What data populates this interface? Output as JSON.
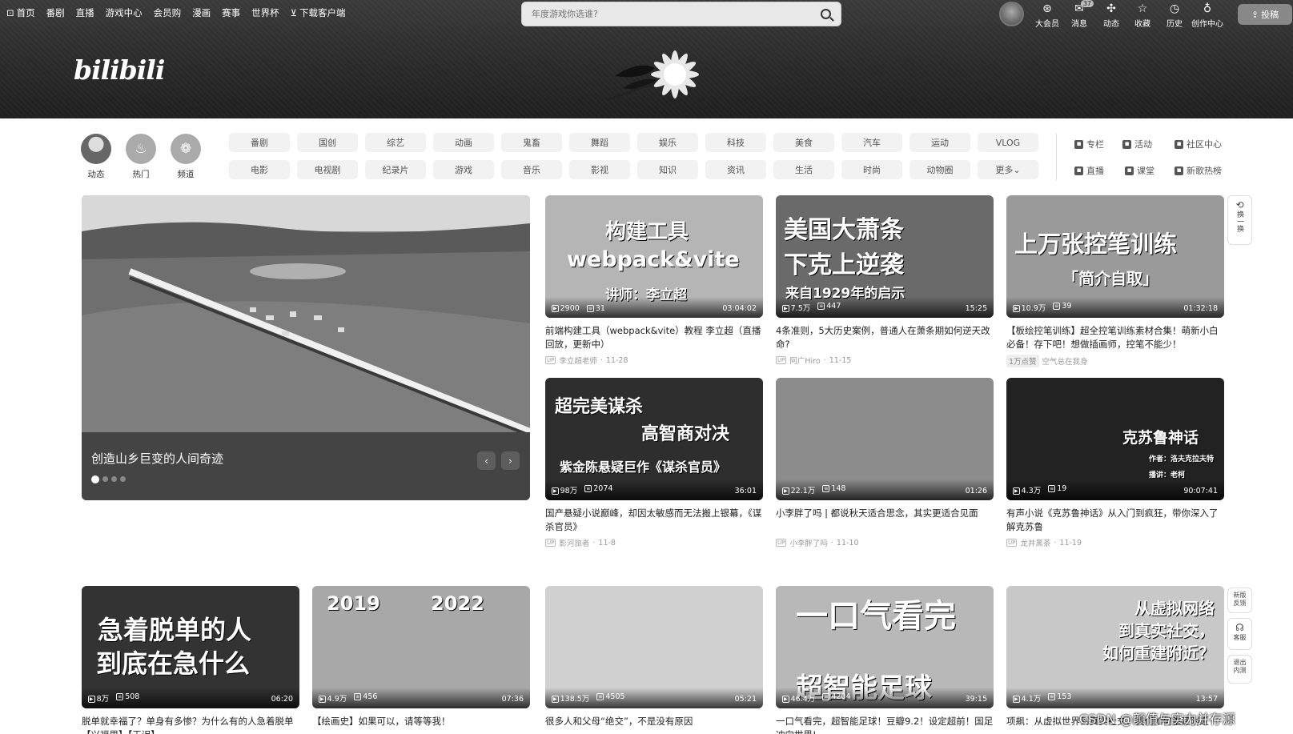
{
  "topnav": [
    "首页",
    "番剧",
    "直播",
    "游戏中心",
    "会员购",
    "漫画",
    "赛事",
    "世界杯",
    "下载客户端"
  ],
  "search": {
    "placeholder": "年度游戏你选谁?"
  },
  "right_icons": [
    {
      "icon": "vip-icon",
      "label": "大会员",
      "glyph": "⊛"
    },
    {
      "icon": "message-icon",
      "label": "消息",
      "glyph": "✉",
      "badge": "37"
    },
    {
      "icon": "dynamic-icon",
      "label": "动态",
      "glyph": "✣"
    },
    {
      "icon": "favorite-icon",
      "label": "收藏",
      "glyph": "☆"
    },
    {
      "icon": "history-icon",
      "label": "历史",
      "glyph": "◷"
    },
    {
      "icon": "creation-icon",
      "label": "创作中心",
      "glyph": "♁"
    }
  ],
  "upload_label": "投稿",
  "logo": "bilibili",
  "side_channels": [
    {
      "label": "动态",
      "icon": "avatar"
    },
    {
      "label": "热门",
      "icon": "fire-icon"
    },
    {
      "label": "频道",
      "icon": "channel-icon"
    }
  ],
  "categories": [
    "番剧",
    "国创",
    "综艺",
    "动画",
    "鬼畜",
    "舞蹈",
    "娱乐",
    "科技",
    "美食",
    "汽车",
    "运动",
    "VLOG",
    "电影",
    "电视剧",
    "纪录片",
    "游戏",
    "音乐",
    "影视",
    "知识",
    "资讯",
    "生活",
    "时尚",
    "动物圈",
    "更多"
  ],
  "extra_links": [
    {
      "label": "专栏",
      "icon": "column-icon"
    },
    {
      "label": "活动",
      "icon": "flag-icon"
    },
    {
      "label": "社区中心",
      "icon": "community-icon"
    },
    {
      "label": "直播",
      "icon": "live-icon"
    },
    {
      "label": "课堂",
      "icon": "classroom-icon"
    },
    {
      "label": "新歌热榜",
      "icon": "music-icon"
    }
  ],
  "carousel": {
    "title": "创造山乡巨变的人间奇迹"
  },
  "refresh_label": "换一换",
  "cards": [
    {
      "title": "前端构建工具（webpack&vite）教程 李立超（直播回放，更新中）",
      "up": "李立超老师",
      "date": "11-28",
      "views": "2900",
      "danmaku": "31",
      "duration": "03:04:02",
      "thumb_text": [
        "构建工具",
        "webpack&vite",
        "讲师：李立超"
      ]
    },
    {
      "title": "4条准则，5大历史案例，普通人在萧条期如何逆天改命?",
      "up": "阿广Hiro",
      "date": "11-15",
      "views": "7.5万",
      "danmaku": "447",
      "duration": "15:25",
      "thumb_text": [
        "美国大萧条",
        "下克上逆袭",
        "来自1929年的启示"
      ]
    },
    {
      "title": "【板绘控笔训练】超全控笔训练素材合集！萌新小白必备！存下吧！想做插画师，控笔不能少！",
      "up": "空气总在我身",
      "date": "",
      "likes": "1万点赞",
      "views": "10.9万",
      "danmaku": "39",
      "duration": "01:32:18",
      "thumb_text": [
        "上万张控笔训练",
        "「简介自取」"
      ]
    },
    {
      "title": "国产悬疑小说巅峰，却因太敏感而无法搬上银幕，《谋杀官员》",
      "up": "影河旅者",
      "date": "11-8",
      "views": "98万",
      "danmaku": "2074",
      "duration": "36:01",
      "thumb_text": [
        "超完美谋杀",
        "高智商对决",
        "紫金陈悬疑巨作《谋杀官员》"
      ]
    },
    {
      "title": "小李胖了吗 | 都说秋天适合思念，其实更适合见面",
      "up": "小李胖了吗",
      "date": "11-10",
      "views": "22.1万",
      "danmaku": "148",
      "duration": "01:26",
      "thumb_text": []
    },
    {
      "title": "有声小说《克苏鲁神话》从入门到疯狂，带你深入了解克苏鲁",
      "up": "龙井黑茶",
      "date": "11-19",
      "views": "4.3万",
      "danmaku": "19",
      "duration": "90:07:41",
      "thumb_text": [
        "克苏鲁神话",
        "作者：洛夫克拉夫特",
        "播讲：老柯"
      ]
    },
    {
      "title": "脱单就幸福了？单身有多惨？为什么有的人急着脱单【兴福里】【王迟】",
      "views": "8万",
      "danmaku": "508",
      "duration": "06:20",
      "thumb_text": [
        "急着脱单的人",
        "到底在急什么"
      ]
    },
    {
      "title": "【绘画史】如果可以，请等等我！",
      "views": "4.9万",
      "danmaku": "456",
      "duration": "07:36",
      "thumb_text": [
        "2019",
        "2022"
      ]
    },
    {
      "title": "很多人和父母“绝交”，不是没有原因",
      "views": "138.5万",
      "danmaku": "4505",
      "duration": "05:21",
      "thumb_text": []
    },
    {
      "title": "一口气看完，超智能足球！豆瓣9.2！设定超前！国足冲向世界!",
      "views": "46.4万",
      "danmaku": "4204",
      "duration": "39:15",
      "thumb_text": [
        "一口气看完",
        "超智能足球"
      ]
    },
    {
      "title": "项飙：从虚拟世界到真实社交，我们如何重建附近",
      "views": "4.1万",
      "danmaku": "153",
      "duration": "13:57",
      "thumb_text": [
        "从虚拟网络",
        "到真实社交，",
        "如何重建附近？"
      ]
    }
  ],
  "right_side": [
    "新版反馈",
    "客服",
    "退出内测"
  ],
  "watermark": "CSDN @颜值与实力并存源"
}
